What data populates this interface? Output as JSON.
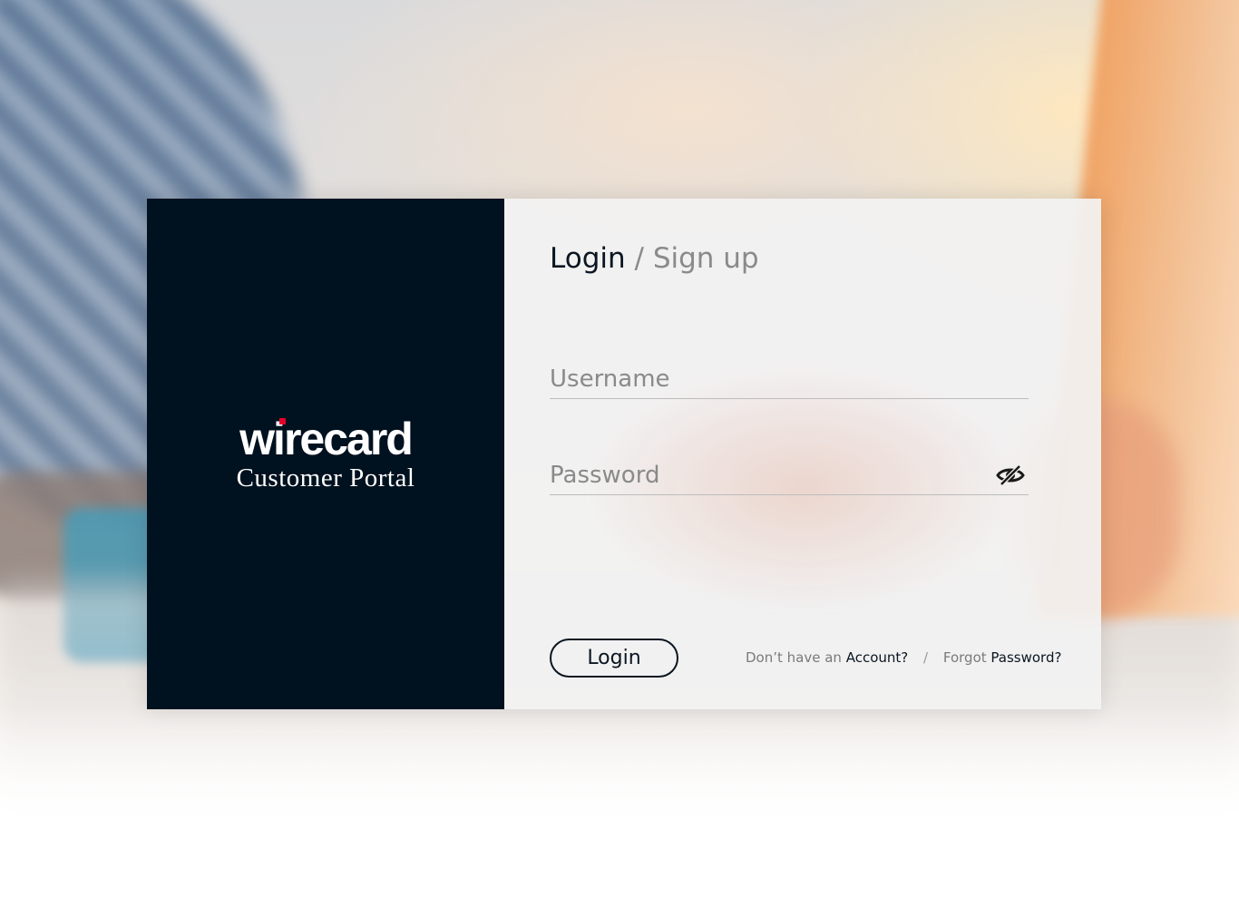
{
  "brand": {
    "logo_text": "wirecard",
    "subtitle": "Customer Portal",
    "accent_color": "#e4002b",
    "panel_color": "#00111f"
  },
  "auth": {
    "heading_active": "Login",
    "heading_separator": "/",
    "heading_inactive": "Sign up",
    "username_placeholder": "Username",
    "password_placeholder": "Password",
    "password_toggle_icon": "eye-slash-icon",
    "login_button_label": "Login",
    "account_prefix": "Don’t have an",
    "account_link": "Account?",
    "links_separator": "/",
    "forgot_prefix": "Forgot",
    "forgot_link": "Password?"
  }
}
